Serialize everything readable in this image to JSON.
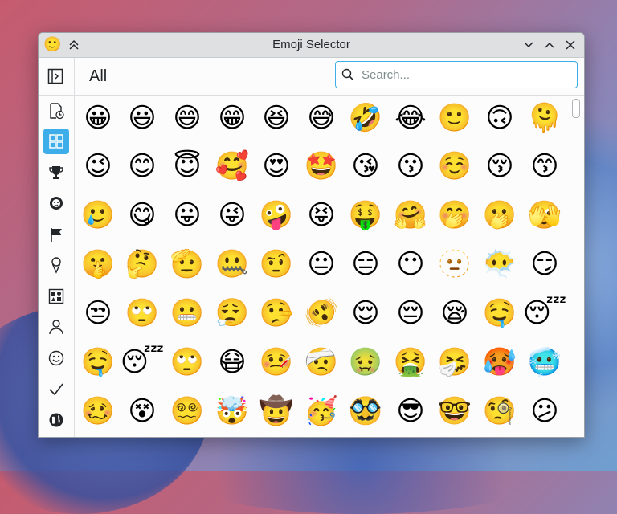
{
  "window": {
    "title": "Emoji Selector",
    "app_icon": "🙂"
  },
  "header": {
    "title": "All"
  },
  "search": {
    "placeholder": "Search...",
    "value": ""
  },
  "sidebar": {
    "items": [
      {
        "name": "recent",
        "icon": "recent-document-icon"
      },
      {
        "name": "all",
        "icon": "grid-view-icon",
        "active": true
      },
      {
        "name": "activities",
        "icon": "trophy-icon"
      },
      {
        "name": "animals-nature",
        "icon": "animal-face-icon"
      },
      {
        "name": "flags",
        "icon": "flag-icon"
      },
      {
        "name": "food-drink",
        "icon": "ice-cream-icon"
      },
      {
        "name": "objects",
        "icon": "shapes-icon"
      },
      {
        "name": "people-body",
        "icon": "person-icon"
      },
      {
        "name": "smileys-emotion",
        "icon": "smiley-icon"
      },
      {
        "name": "symbols",
        "icon": "checkmark-icon"
      },
      {
        "name": "travel-places",
        "icon": "globe-icon"
      }
    ]
  },
  "emojis": [
    [
      "😀",
      "😃",
      "😄",
      "😁",
      "😆",
      "😅",
      "🤣",
      "😂",
      "🙂",
      "🙃",
      "🫠"
    ],
    [
      "😉",
      "😊",
      "😇",
      "🥰",
      "😍",
      "🤩",
      "😘",
      "😗",
      "☺️",
      "😚",
      "😙"
    ],
    [
      "🥲",
      "😋",
      "😛",
      "😜",
      "🤪",
      "😝",
      "🤑",
      "🤗",
      "🤭",
      "🫢",
      "🫣"
    ],
    [
      "🤫",
      "🤔",
      "🫡",
      "🤐",
      "🤨",
      "😐",
      "😑",
      "😶",
      "🫥",
      "😶‍🌫️",
      "😏"
    ],
    [
      "😒",
      "🙄",
      "😬",
      "😮‍💨",
      "🤥",
      "🫨",
      "😌",
      "😔",
      "😪",
      "🤤",
      "😴"
    ],
    [
      "🤤",
      "😴",
      "🙄",
      "😷",
      "🤒",
      "🤕",
      "🤢",
      "🤮",
      "🤧",
      "🥵",
      "🥶"
    ],
    [
      "🥴",
      "😵",
      "😵‍💫",
      "🤯",
      "🤠",
      "🥳",
      "🥸",
      "😎",
      "🤓",
      "🧐",
      "😕"
    ]
  ]
}
